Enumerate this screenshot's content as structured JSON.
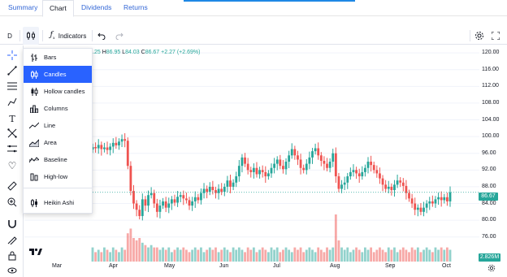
{
  "tabs": [
    {
      "label": "Summary"
    },
    {
      "label": "Chart"
    },
    {
      "label": "Dividends"
    },
    {
      "label": "Returns"
    }
  ],
  "toolbar": {
    "interval": "D",
    "indicators_label": "Indicators"
  },
  "legend": {
    "ohlc_tail": ".25",
    "high_label": "H",
    "high": "86.95",
    "low_label": "L",
    "low": "84.03",
    "close_label": "C",
    "close": "86.67",
    "change": "+2.27 (+2.69%)"
  },
  "chart_type_menu": {
    "items": [
      {
        "label": "Bars",
        "icon": "bars-icon"
      },
      {
        "label": "Candles",
        "icon": "candles-icon",
        "selected": true
      },
      {
        "label": "Hollow candles",
        "icon": "hollow-candles-icon"
      },
      {
        "label": "Columns",
        "icon": "columns-icon"
      },
      {
        "label": "Line",
        "icon": "line-icon"
      },
      {
        "label": "Area",
        "icon": "area-icon"
      },
      {
        "label": "Baseline",
        "icon": "baseline-icon"
      },
      {
        "label": "High-low",
        "icon": "high-low-icon"
      },
      {
        "label": "Heikin Ashi",
        "icon": "heikin-ashi-icon"
      }
    ]
  },
  "price_badge": "86.67",
  "volume_badge": "2.826M",
  "colors": {
    "up": "#26a69a",
    "down": "#ef5350",
    "accent": "#2962ff",
    "tab_link": "#3367d6"
  },
  "chart_data": {
    "type": "candlestick",
    "y_ticks": [
      "120.00",
      "116.00",
      "112.00",
      "108.00",
      "104.00",
      "100.00",
      "96.00",
      "92.00",
      "88.00",
      "84.00",
      "80.00",
      "76.00"
    ],
    "ylim": [
      74,
      121
    ],
    "x_ticks": [
      "Mar",
      "Apr",
      "May",
      "Jun",
      "Jul",
      "Aug",
      "Sep",
      "Oct"
    ],
    "last_close": 86.67,
    "last_volume": "2.826M",
    "closes": [
      97.5,
      97.2,
      98.0,
      97.0,
      97.4,
      96.8,
      97.6,
      98.5,
      97.9,
      98.8,
      99.4,
      99.0,
      93.0,
      87.0,
      84.0,
      82.5,
      81.0,
      85.0,
      83.5,
      86.0,
      86.5,
      84.0,
      82.0,
      83.5,
      84.5,
      83.0,
      84.0,
      85.0,
      84.2,
      85.6,
      86.0,
      85.2,
      84.8,
      83.5,
      84.5,
      85.5,
      84.8,
      86.5,
      87.5,
      86.8,
      88.0,
      87.2,
      86.5,
      87.5,
      86.8,
      88.0,
      89.5,
      88.0,
      89.0,
      90.5,
      93.0,
      95.0,
      93.5,
      92.0,
      91.5,
      92.5,
      91.0,
      92.0,
      91.5,
      90.5,
      91.2,
      92.5,
      93.5,
      94.5,
      93.0,
      92.2,
      94.0,
      95.5,
      97.0,
      95.5,
      94.5,
      92.5,
      92.0,
      93.5,
      95.0,
      96.5,
      97.2,
      95.5,
      94.2,
      93.5,
      92.5,
      94.0,
      96.0,
      90.5,
      87.5,
      88.5,
      89.0,
      90.5,
      91.5,
      92.0,
      91.2,
      90.5,
      91.5,
      92.5,
      94.0,
      93.2,
      92.0,
      91.2,
      90.0,
      88.5,
      87.5,
      88.0,
      87.2,
      88.5,
      89.5,
      89.0,
      88.2,
      86.5,
      85.2,
      84.0,
      82.5,
      83.0,
      82.0,
      83.0,
      84.0,
      84.5,
      84.0,
      85.0,
      85.5,
      84.8,
      85.5,
      84.5,
      86.67
    ],
    "volumes_relative": [
      0.3,
      0.2,
      0.25,
      0.2,
      0.3,
      0.25,
      0.2,
      0.3,
      0.25,
      0.2,
      0.3,
      0.25,
      0.6,
      0.7,
      0.5,
      0.45,
      0.5,
      0.4,
      0.35,
      0.3,
      0.35,
      0.3,
      0.3,
      0.25,
      0.3,
      0.25,
      0.3,
      0.2,
      0.25,
      0.3,
      0.25,
      0.3,
      0.25,
      0.2,
      0.25,
      0.3,
      0.25,
      0.3,
      0.2,
      0.25,
      0.3,
      0.25,
      0.3,
      0.2,
      0.25,
      0.3,
      0.25,
      0.2,
      0.3,
      0.25,
      0.3,
      0.25,
      0.2,
      0.3,
      0.25,
      0.3,
      0.2,
      0.25,
      0.3,
      0.25,
      0.2,
      0.3,
      0.25,
      0.3,
      0.2,
      0.25,
      0.3,
      0.25,
      0.2,
      0.3,
      0.25,
      0.3,
      0.2,
      0.25,
      0.3,
      0.25,
      0.2,
      0.3,
      0.25,
      0.2,
      0.3,
      0.25,
      0.3,
      1.0,
      0.45,
      0.3,
      0.25,
      0.3,
      0.2,
      0.25,
      0.3,
      0.25,
      0.2,
      0.3,
      0.25,
      0.3,
      0.2,
      0.25,
      0.3,
      0.25,
      0.2,
      0.3,
      0.25,
      0.3,
      0.2,
      0.25,
      0.3,
      0.25,
      0.2,
      0.3,
      0.25,
      0.3,
      0.2,
      0.25,
      0.3,
      0.25,
      0.2,
      0.3,
      0.25,
      0.3,
      0.25,
      0.3
    ]
  }
}
